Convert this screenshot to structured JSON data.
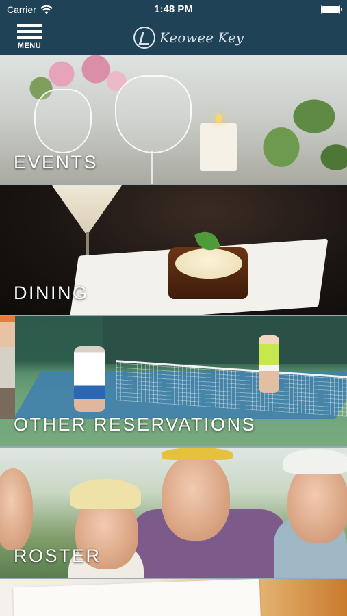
{
  "status_bar": {
    "carrier": "Carrier",
    "time": "1:48 PM",
    "icons": [
      "wifi-icon",
      "battery-icon"
    ]
  },
  "nav": {
    "menu_label": "MENU",
    "logo_text": "Keowee Key",
    "background_color": "#1f4257"
  },
  "tiles": [
    {
      "label": "EVENTS"
    },
    {
      "label": "DINING"
    },
    {
      "label": "OTHER RESERVATIONS"
    },
    {
      "label": "ROSTER"
    }
  ]
}
